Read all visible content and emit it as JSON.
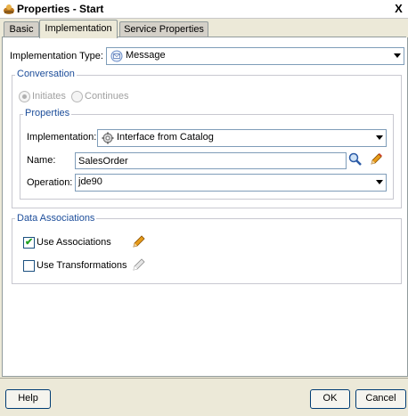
{
  "window": {
    "title": "Properties - Start",
    "close_label": "X"
  },
  "tabs": [
    {
      "label": "Basic"
    },
    {
      "label": "Implementation"
    },
    {
      "label": "Service Properties"
    }
  ],
  "implementation_type": {
    "label": "Implementation Type:",
    "value": "Message"
  },
  "conversation": {
    "title": "Conversation",
    "options": [
      {
        "label": "Initiates",
        "selected": true
      },
      {
        "label": "Continues",
        "selected": false
      }
    ]
  },
  "properties": {
    "title": "Properties",
    "implementation": {
      "label": "Implementation:",
      "value": "Interface from Catalog"
    },
    "name": {
      "label": "Name:",
      "value": "SalesOrder"
    },
    "operation": {
      "label": "Operation:",
      "value": "jde90"
    }
  },
  "data_associations": {
    "title": "Data Associations",
    "use_associations": {
      "label": "Use Associations",
      "checked": true
    },
    "use_transformations": {
      "label": "Use Transformations",
      "checked": false
    }
  },
  "buttons": {
    "help": "Help",
    "ok": "OK",
    "cancel": "Cancel"
  },
  "colors": {
    "group_title": "#1c4d9a",
    "check_green": "#21a121",
    "edit_orange": "#e69b1a"
  }
}
